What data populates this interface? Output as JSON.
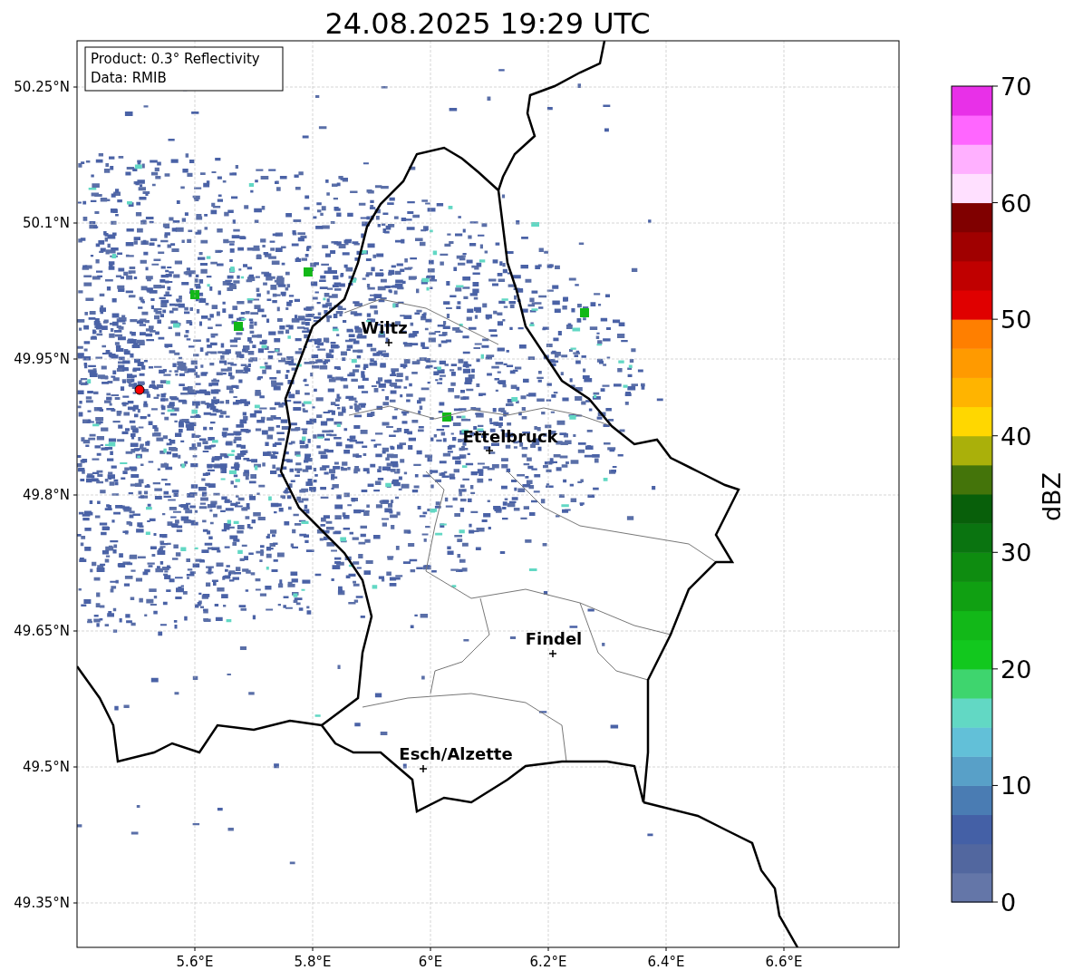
{
  "title": "24.08.2025 19:29 UTC",
  "legend": [
    "Product: 0.3° Reflectivity",
    "Data: RMIB"
  ],
  "y_ticks": [
    "50.25°N",
    "50.1°N",
    "49.95°N",
    "49.8°N",
    "49.65°N",
    "49.5°N",
    "49.35°N"
  ],
  "x_ticks": [
    "5.6°E",
    "5.8°E",
    "6°E",
    "6.2°E",
    "6.4°E",
    "6.6°E"
  ],
  "cities": [
    "Wiltz",
    "Ettelbruck",
    "Findel",
    "Esch/Alzette"
  ],
  "colorbar": {
    "label": "dBZ",
    "ticks": [
      "70",
      "60",
      "50",
      "40",
      "30",
      "20",
      "10",
      "0"
    ]
  }
}
